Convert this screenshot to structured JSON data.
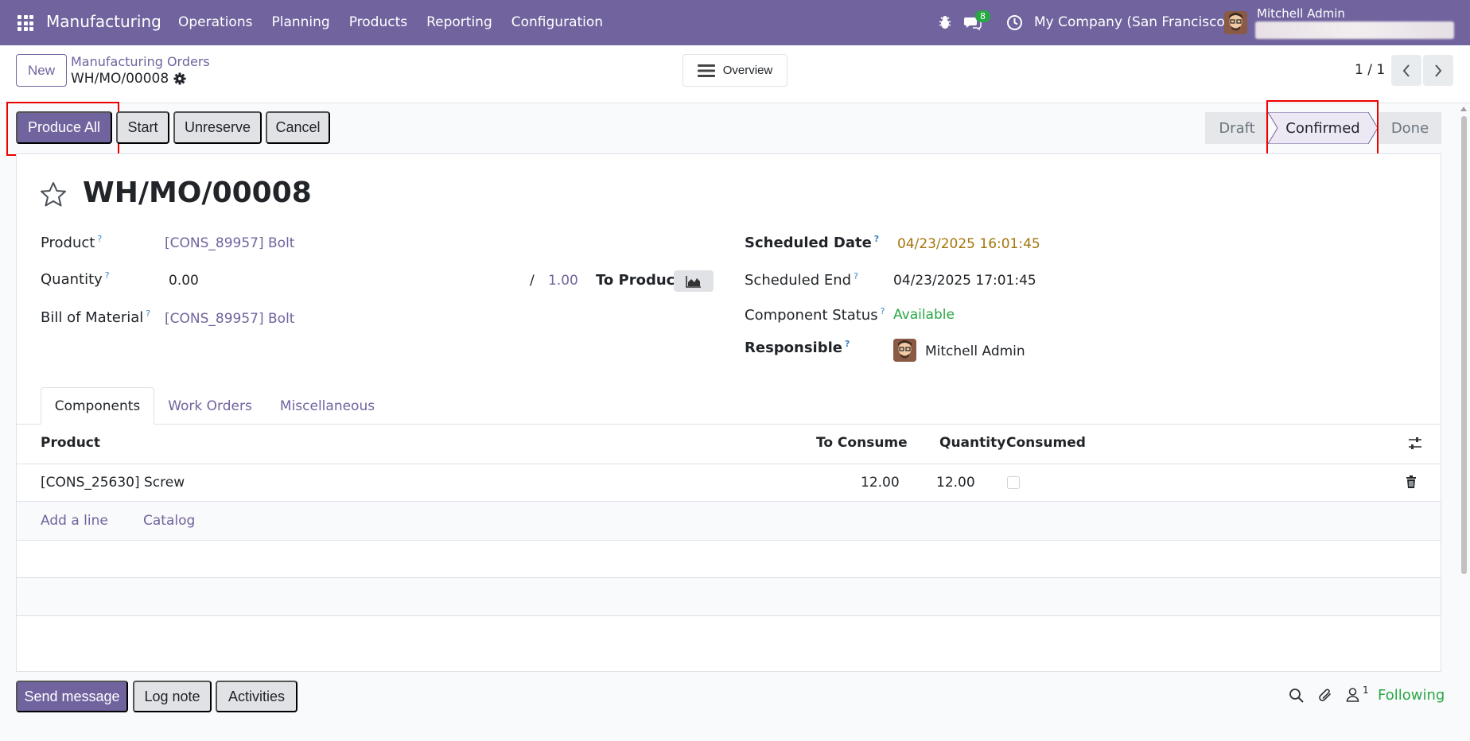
{
  "navbar": {
    "app_name": "Manufacturing",
    "menu": [
      "Operations",
      "Planning",
      "Products",
      "Reporting",
      "Configuration"
    ],
    "messages_count": "8",
    "company": "My Company (San Francisco)",
    "user_name": "Mitchell Admin"
  },
  "control_panel": {
    "new_label": "New",
    "breadcrumb_parent": "Manufacturing Orders",
    "breadcrumb_current": "WH/MO/00008",
    "overview_label": "Overview",
    "pager": "1 / 1"
  },
  "actions": {
    "produce_all": "Produce All",
    "start": "Start",
    "unreserve": "Unreserve",
    "cancel": "Cancel"
  },
  "stages": {
    "draft": "Draft",
    "confirmed": "Confirmed",
    "done": "Done",
    "current": "Confirmed"
  },
  "record": {
    "title": "WH/MO/00008",
    "product_label": "Product",
    "product_value": "[CONS_89957] Bolt",
    "quantity_label": "Quantity",
    "quantity_value": "0.00",
    "quantity_separator": "/",
    "quantity_target": "1.00",
    "to_produce_label": "To Produce",
    "bom_label": "Bill of Material",
    "bom_value": "[CONS_89957] Bolt",
    "scheduled_date_label": "Scheduled Date",
    "scheduled_date_value": "04/23/2025 16:01:45",
    "scheduled_end_label": "Scheduled End",
    "scheduled_end_value": "04/23/2025 17:01:45",
    "component_status_label": "Component Status",
    "component_status_value": "Available",
    "responsible_label": "Responsible",
    "responsible_value": "Mitchell Admin"
  },
  "tabs": [
    "Components",
    "Work Orders",
    "Miscellaneous"
  ],
  "components_table": {
    "headers": {
      "product": "Product",
      "to_consume": "To Consume",
      "quantity": "Quantity",
      "consumed": "Consumed"
    },
    "rows": [
      {
        "product": "[CONS_25630] Screw",
        "to_consume": "12.00",
        "quantity": "12.00",
        "consumed": false
      }
    ],
    "add_line": "Add a line",
    "catalog": "Catalog"
  },
  "chatter": {
    "send_message": "Send message",
    "log_note": "Log note",
    "activities": "Activities",
    "followers_count": "1",
    "following": "Following"
  },
  "colors": {
    "brand": "#71639e",
    "highlight": "#ee0000",
    "success": "#28a745",
    "warning": "#a5760d"
  }
}
